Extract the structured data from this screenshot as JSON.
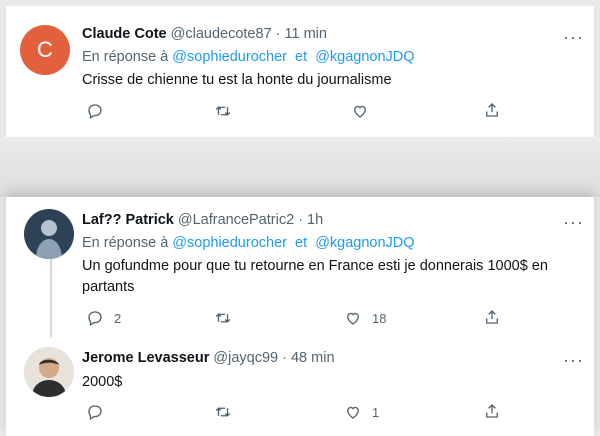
{
  "tweets": [
    {
      "avatar_letter": "C",
      "avatar_color": "#e2603b",
      "name": "Claude Cote",
      "handle": "@claudecote87",
      "time": "· 11 min",
      "reply_prefix": "En réponse à",
      "reply_user1": "@sophiedurocher",
      "reply_sep": "et",
      "reply_user2": "@kgagnonJDQ",
      "text": "Crisse de chienne tu est la honte du journalisme"
    },
    {
      "name": "Laf?? Patrick",
      "handle": "@LafrancePatric2",
      "time": "· 1h",
      "reply_prefix": "En réponse à",
      "reply_user1": "@sophiedurocher",
      "reply_sep": "et",
      "reply_user2": "@kgagnonJDQ",
      "text_line1": "Un gofundme pour que tu retourne en France esti je donnerais 1000$ en",
      "text_line2": "partants",
      "reply_count": "2",
      "like_count": "18"
    },
    {
      "name": "Jerome Levasseur",
      "handle": "@jayqc99",
      "time": "· 48 min",
      "text": "2000$",
      "like_count": "1"
    }
  ],
  "colors": {
    "link": "#1d9bf0",
    "muted": "#536471",
    "text": "#0f1419"
  },
  "icons": [
    "reply-icon",
    "retweet-icon",
    "like-icon",
    "share-icon",
    "more-icon"
  ]
}
